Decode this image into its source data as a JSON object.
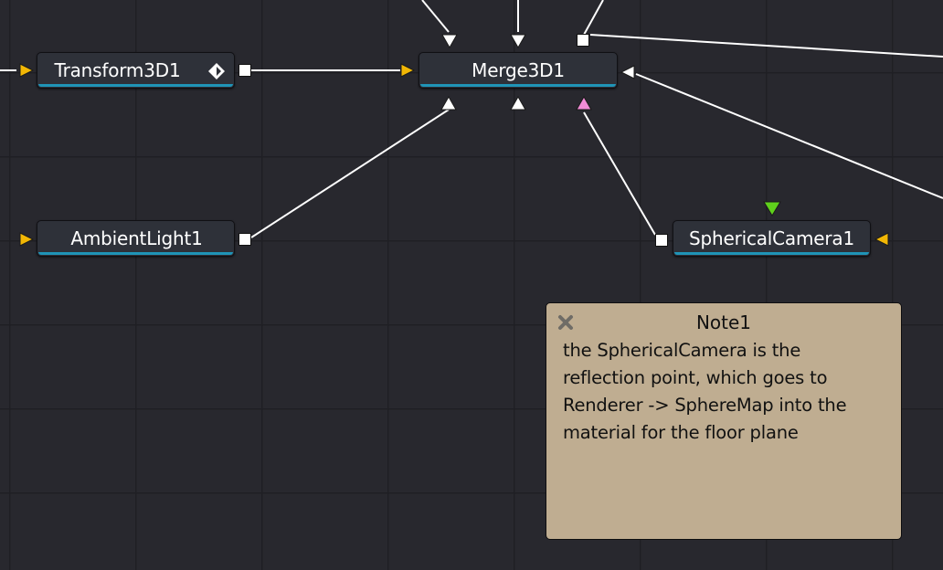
{
  "colors": {
    "canvas_background": "#28282e",
    "grid_line": "#1f1f24",
    "node_fill": "#2e3139",
    "node_accent_stripe": "#1f94b7",
    "wire": "#ffffff",
    "input_yellow": "#f2b705",
    "input_pink": "#f28cd7",
    "input_green": "#5fd01c",
    "note_fill": "#bfad91"
  },
  "nodes": {
    "transform": {
      "label": "Transform3D1",
      "icon": "diamond-icon"
    },
    "merge": {
      "label": "Merge3D1"
    },
    "ambient": {
      "label": "AmbientLight1"
    },
    "camera": {
      "label": "SphericalCamera1"
    }
  },
  "note": {
    "close_icon": "close-x-icon",
    "title": "Note1",
    "lines": [
      "the SphericalCamera is the",
      "reflection point, which goes to",
      "Renderer -> SphereMap into the",
      "material for the floor plane"
    ]
  }
}
